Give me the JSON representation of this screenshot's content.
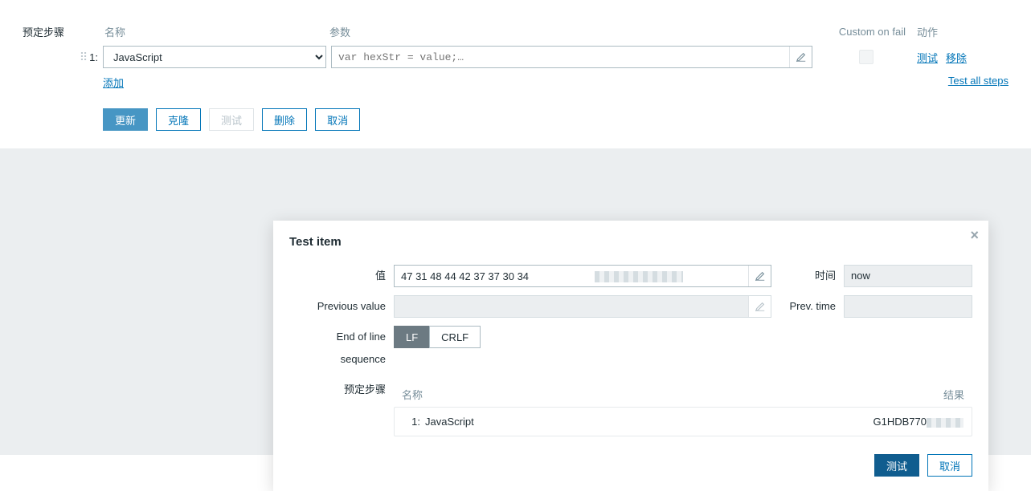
{
  "headers": {
    "presteps": "预定步骤",
    "name": "名称",
    "param": "参数",
    "custom_on_fail": "Custom on fail",
    "action": "动作"
  },
  "step": {
    "index": "1:",
    "name": "JavaScript",
    "param_placeholder": "var hexStr = value;…",
    "action_test": "测试",
    "action_remove": "移除"
  },
  "add_label": "添加",
  "test_all_label": "Test all steps",
  "footer_buttons": {
    "update": "更新",
    "clone": "克隆",
    "test": "测试",
    "delete": "删除",
    "cancel": "取消"
  },
  "modal": {
    "title": "Test item",
    "value_label": "值",
    "value": "47 31 48 44 42 37 37 30 34 ",
    "time_label": "时间",
    "time_value": "now",
    "prev_value_label": "Previous value",
    "prev_value": "",
    "prev_time_label": "Prev. time",
    "prev_time_value": "",
    "eol_label": "End of line sequence",
    "eol_options": {
      "lf": "LF",
      "crlf": "CRLF"
    },
    "steps_label": "预定步骤",
    "steps_header_name": "名称",
    "steps_header_result": "结果",
    "step_row": {
      "index": "1:",
      "name": "JavaScript",
      "result": "G1HDB770"
    },
    "btn_test": "测试",
    "btn_cancel": "取消"
  }
}
